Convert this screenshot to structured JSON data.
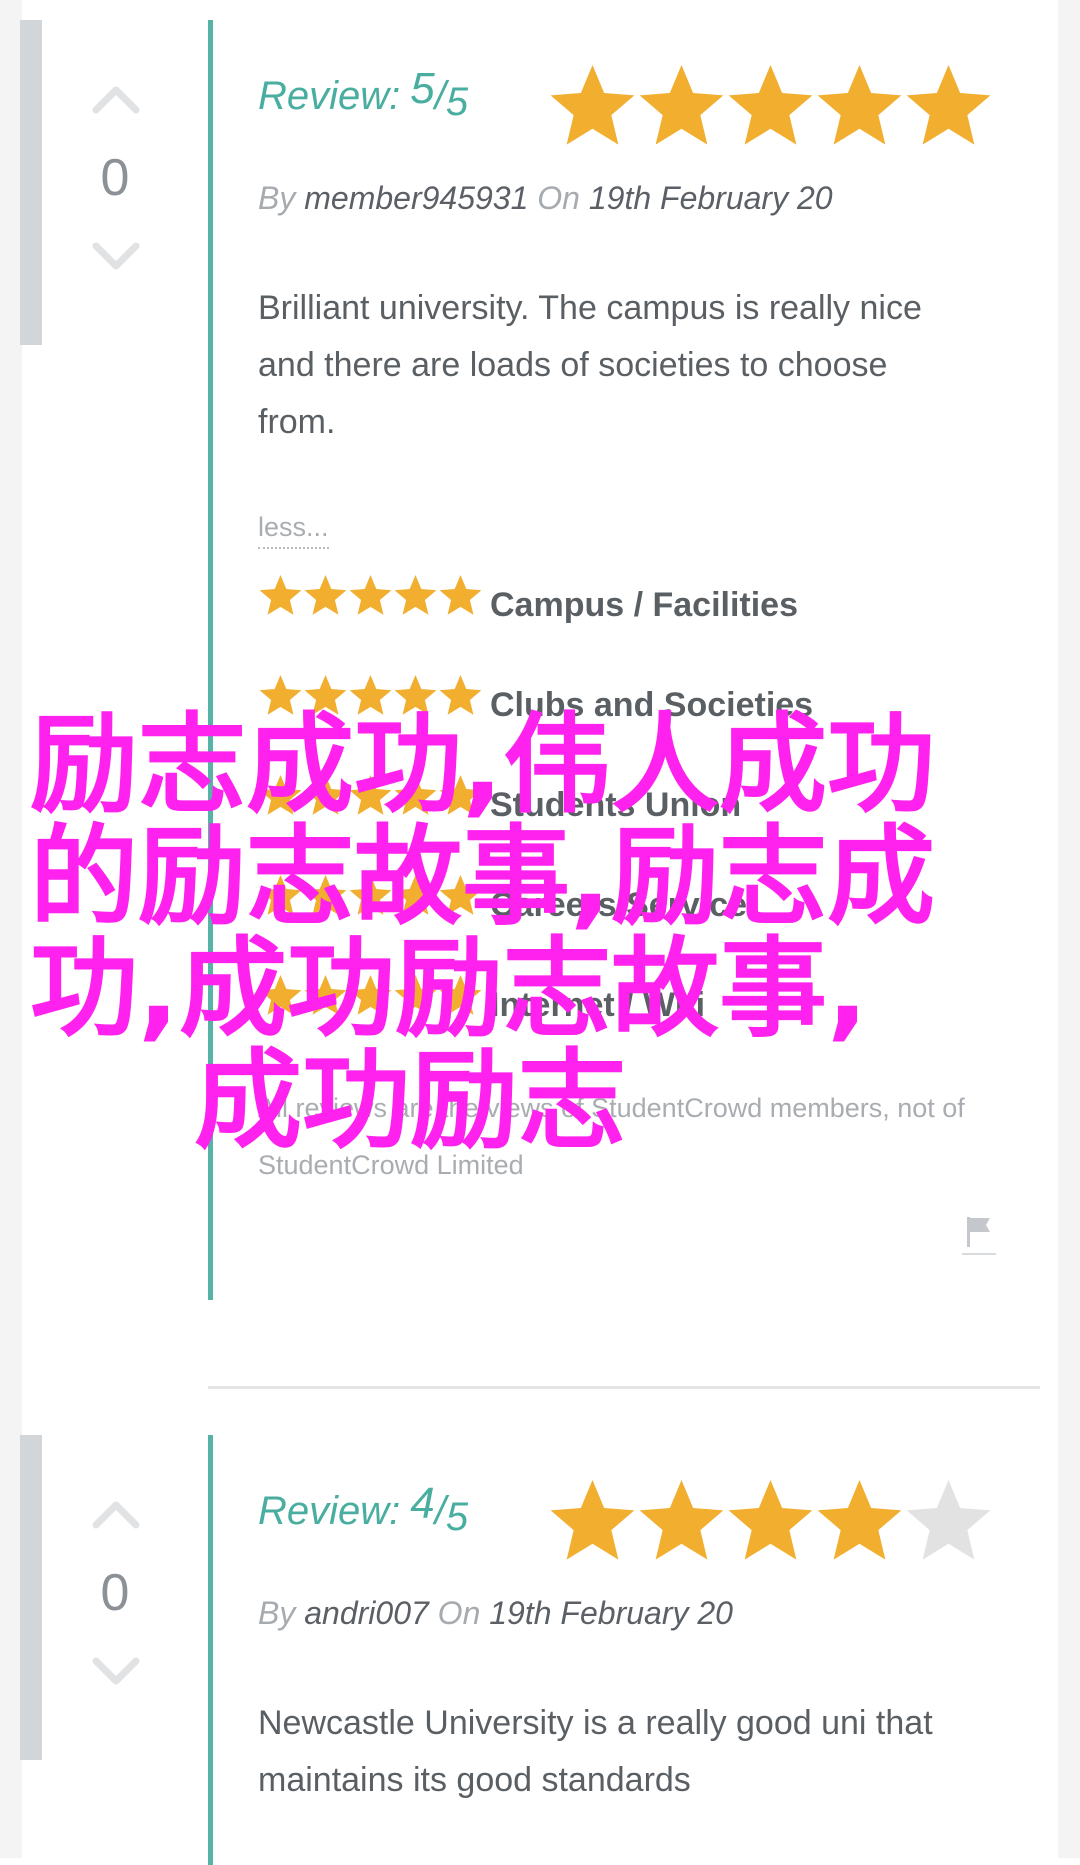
{
  "reviews": [
    {
      "vote_count": "0",
      "title": {
        "label": "Review:",
        "score": "5",
        "slash": "/",
        "max": "5"
      },
      "rating": 5,
      "byline": {
        "by": "By",
        "author": "member945931",
        "on": "On",
        "date": "19th February 20"
      },
      "body": "Brilliant university. The campus is really nice and there are loads of societies to choose from.",
      "less_label": "less...",
      "categories": [
        {
          "label": "Campus / Facilities",
          "rating": 5
        },
        {
          "label": "Clubs and Societies",
          "rating": 5
        },
        {
          "label": "Students Union",
          "rating": 5
        },
        {
          "label": "Careers Service",
          "rating": 5
        },
        {
          "label": "Internet / Wifi",
          "rating": 5
        }
      ],
      "disclaimer": "All reviews are the views of StudentCrowd members, not of StudentCrowd Limited"
    },
    {
      "vote_count": "0",
      "title": {
        "label": "Review:",
        "score": "4",
        "slash": "/",
        "max": "5"
      },
      "rating": 4,
      "byline": {
        "by": "By",
        "author": "andri007",
        "on": "On",
        "date": "19th February 20"
      },
      "body": "Newcastle University is a really good uni that maintains its good standards"
    }
  ],
  "watermark": {
    "lines": [
      "励志成功,伟人成功",
      "的励志故事,励志成",
      "功,成功励志故事,",
      "成功励志"
    ]
  },
  "colors": {
    "accent": "#56b3a6",
    "star_filled": "#f1ae2f",
    "star_empty": "#e2e2e2",
    "watermark": "#ff22ee"
  },
  "icons": {
    "vote_up": "chevron-up-icon",
    "vote_down": "chevron-down-icon",
    "star": "star-icon",
    "flag": "flag-icon"
  }
}
